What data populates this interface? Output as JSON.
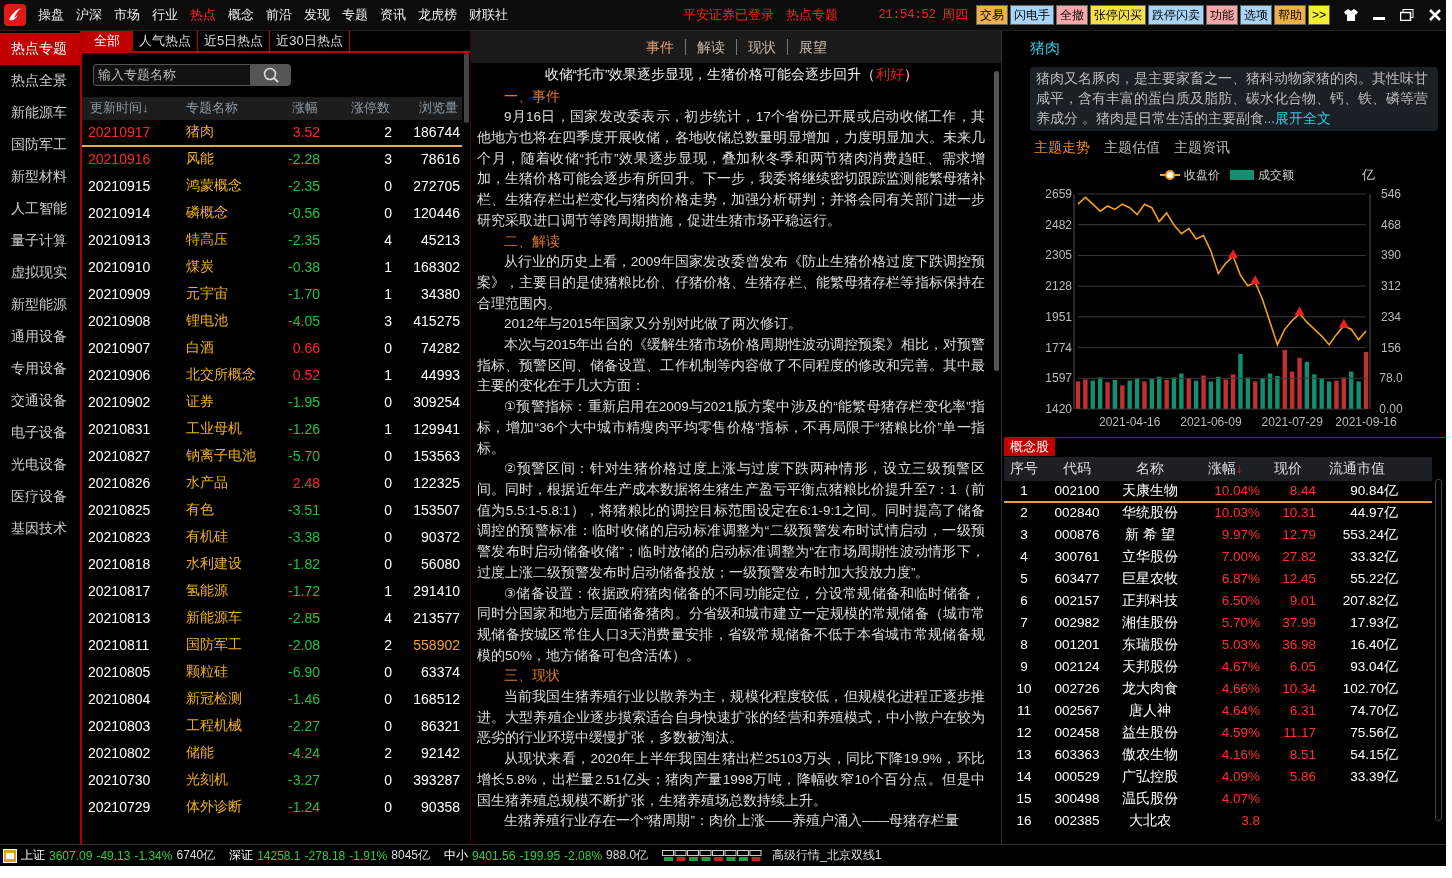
{
  "menu": {
    "items": [
      {
        "label": "操盘",
        "selected": false
      },
      {
        "label": "沪深",
        "selected": false
      },
      {
        "label": "市场",
        "selected": false
      },
      {
        "label": "行业",
        "selected": false
      },
      {
        "label": "热点",
        "selected": true
      },
      {
        "label": "概念",
        "selected": false
      },
      {
        "label": "前沿",
        "selected": false
      },
      {
        "label": "发现",
        "selected": false
      },
      {
        "label": "专题",
        "selected": false
      },
      {
        "label": "资讯",
        "selected": false
      },
      {
        "label": "龙虎榜",
        "selected": false
      },
      {
        "label": "财联社",
        "selected": false
      }
    ],
    "login_status": "平安证券已登录",
    "page_title": "热点专题",
    "time": "21:54:52",
    "weekday": "周四",
    "buttons": [
      {
        "label": "交易",
        "color": "#f0b048"
      },
      {
        "label": "闪电手",
        "color": "#a8d4f8"
      },
      {
        "label": "全撤",
        "color": "#f8a8a8"
      },
      {
        "label": "张停闪买",
        "color": "#f8e048"
      },
      {
        "label": "跌停闪卖",
        "color": "#a8d4f8"
      },
      {
        "label": "功能",
        "color": "#f8a8a8"
      },
      {
        "label": "选项",
        "color": "#a8d4f8"
      },
      {
        "label": "帮助",
        "color": "#f0b048"
      },
      {
        "label": ">>",
        "color": "#f0f030"
      }
    ]
  },
  "sidebar": {
    "items": [
      {
        "label": "热点专题",
        "selected": true
      },
      {
        "label": "热点全景",
        "selected": false
      },
      {
        "label": "新能源车",
        "selected": false
      },
      {
        "label": "国防军工",
        "selected": false
      },
      {
        "label": "新型材料",
        "selected": false
      },
      {
        "label": "人工智能",
        "selected": false
      },
      {
        "label": "量子计算",
        "selected": false
      },
      {
        "label": "虚拟现实",
        "selected": false
      },
      {
        "label": "新型能源",
        "selected": false
      },
      {
        "label": "通用设备",
        "selected": false
      },
      {
        "label": "专用设备",
        "selected": false
      },
      {
        "label": "交通设备",
        "selected": false
      },
      {
        "label": "电子设备",
        "selected": false
      },
      {
        "label": "光电设备",
        "selected": false
      },
      {
        "label": "医疗设备",
        "selected": false
      },
      {
        "label": "基因技术",
        "selected": false
      }
    ]
  },
  "topics": {
    "tabs": [
      {
        "label": "全部",
        "selected": true
      },
      {
        "label": "人气热点",
        "selected": false
      },
      {
        "label": "近5日热点",
        "selected": false
      },
      {
        "label": "近30日热点",
        "selected": false
      }
    ],
    "search": {
      "placeholder": "输入专题名称"
    },
    "columns": [
      "更新时间↓",
      "专题名称",
      "涨幅",
      "涨停数",
      "浏览量"
    ],
    "rows": [
      {
        "date": "20210917",
        "recent": true,
        "name": "猪肉",
        "change": "3.52",
        "color": "#ff2828",
        "limit_ups": "2",
        "views": "186744",
        "top": false,
        "selected": true
      },
      {
        "date": "20210916",
        "recent": true,
        "name": "风能",
        "change": "-2.28",
        "color": "#20c040",
        "limit_ups": "3",
        "views": "78616",
        "top": false,
        "selected": false
      },
      {
        "date": "20210915",
        "recent": false,
        "name": "鸿蒙概念",
        "change": "-2.35",
        "color": "#20c040",
        "limit_ups": "0",
        "views": "272705",
        "top": false,
        "selected": false
      },
      {
        "date": "20210914",
        "recent": false,
        "name": "磷概念",
        "change": "-0.56",
        "color": "#20c040",
        "limit_ups": "0",
        "views": "120446",
        "top": false,
        "selected": false
      },
      {
        "date": "20210913",
        "recent": false,
        "name": "特高压",
        "change": "-2.35",
        "color": "#20c040",
        "limit_ups": "4",
        "views": "45213",
        "top": false,
        "selected": false
      },
      {
        "date": "20210910",
        "recent": false,
        "name": "煤炭",
        "change": "-0.38",
        "color": "#20c040",
        "limit_ups": "1",
        "views": "168302",
        "top": false,
        "selected": false
      },
      {
        "date": "20210909",
        "recent": false,
        "name": "元宇宙",
        "change": "-1.70",
        "color": "#20c040",
        "limit_ups": "1",
        "views": "34380",
        "top": false,
        "selected": false
      },
      {
        "date": "20210908",
        "recent": false,
        "name": "锂电池",
        "change": "-4.05",
        "color": "#20c040",
        "limit_ups": "3",
        "views": "415275",
        "top": false,
        "selected": false
      },
      {
        "date": "20210907",
        "recent": false,
        "name": "白酒",
        "change": "0.66",
        "color": "#ff2828",
        "limit_ups": "0",
        "views": "74282",
        "top": false,
        "selected": false
      },
      {
        "date": "20210906",
        "recent": false,
        "name": "北交所概念",
        "change": "0.52",
        "color": "#ff2828",
        "limit_ups": "1",
        "views": "44993",
        "top": false,
        "selected": false
      },
      {
        "date": "20210902",
        "recent": false,
        "name": "证券",
        "change": "-1.95",
        "color": "#20c040",
        "limit_ups": "0",
        "views": "309254",
        "top": false,
        "selected": false
      },
      {
        "date": "20210831",
        "recent": false,
        "name": "工业母机",
        "change": "-1.26",
        "color": "#20c040",
        "limit_ups": "1",
        "views": "129941",
        "top": false,
        "selected": false
      },
      {
        "date": "20210827",
        "recent": false,
        "name": "钠离子电池",
        "change": "-5.70",
        "color": "#20c040",
        "limit_ups": "0",
        "views": "153563",
        "top": false,
        "selected": false
      },
      {
        "date": "20210826",
        "recent": false,
        "name": "水产品",
        "change": "2.48",
        "color": "#ff2828",
        "limit_ups": "0",
        "views": "122325",
        "top": false,
        "selected": false
      },
      {
        "date": "20210825",
        "recent": false,
        "name": "有色",
        "change": "-3.51",
        "color": "#20c040",
        "limit_ups": "0",
        "views": "153507",
        "top": false,
        "selected": false
      },
      {
        "date": "20210823",
        "recent": false,
        "name": "有机硅",
        "change": "-3.38",
        "color": "#20c040",
        "limit_ups": "0",
        "views": "90372",
        "top": false,
        "selected": false
      },
      {
        "date": "20210818",
        "recent": false,
        "name": "水利建设",
        "change": "-1.82",
        "color": "#20c040",
        "limit_ups": "0",
        "views": "56080",
        "top": false,
        "selected": false
      },
      {
        "date": "20210817",
        "recent": false,
        "name": "氢能源",
        "change": "-1.72",
        "color": "#20c040",
        "limit_ups": "1",
        "views": "291410",
        "top": false,
        "selected": false
      },
      {
        "date": "20210813",
        "recent": false,
        "name": "新能源车",
        "change": "-2.85",
        "color": "#20c040",
        "limit_ups": "4",
        "views": "213577",
        "top": false,
        "selected": false
      },
      {
        "date": "20210811",
        "recent": false,
        "name": "国防军工",
        "change": "-2.08",
        "color": "#20c040",
        "limit_ups": "2",
        "views": "558902",
        "top": true,
        "selected": false
      },
      {
        "date": "20210805",
        "recent": false,
        "name": "颗粒硅",
        "change": "-6.90",
        "color": "#20c040",
        "limit_ups": "0",
        "views": "63374",
        "top": false,
        "selected": false
      },
      {
        "date": "20210804",
        "recent": false,
        "name": "新冠检测",
        "change": "-1.46",
        "color": "#20c040",
        "limit_ups": "0",
        "views": "168512",
        "top": false,
        "selected": false
      },
      {
        "date": "20210803",
        "recent": false,
        "name": "工程机械",
        "change": "-2.27",
        "color": "#20c040",
        "limit_ups": "0",
        "views": "86321",
        "top": false,
        "selected": false
      },
      {
        "date": "20210802",
        "recent": false,
        "name": "储能",
        "change": "-4.24",
        "color": "#20c040",
        "limit_ups": "2",
        "views": "92142",
        "top": false,
        "selected": false
      },
      {
        "date": "20210730",
        "recent": false,
        "name": "光刻机",
        "change": "-3.27",
        "color": "#20c040",
        "limit_ups": "0",
        "views": "393287",
        "top": false,
        "selected": false
      },
      {
        "date": "20210729",
        "recent": false,
        "name": "体外诊断",
        "change": "-1.24",
        "color": "#20c040",
        "limit_ups": "0",
        "views": "90358",
        "top": false,
        "selected": false
      }
    ]
  },
  "article": {
    "tabs": [
      {
        "label": "事件",
        "selected": true
      },
      {
        "label": "解读",
        "selected": false
      },
      {
        "label": "现状",
        "selected": false
      },
      {
        "label": "展望",
        "selected": false
      }
    ],
    "title": "收储“托市”效果逐步显现，生猪价格可能会逐步回升（",
    "title_tag": "利好",
    "title_end": "）",
    "blocks": [
      {
        "kind": "heading",
        "text": "一、事件"
      },
      {
        "kind": "para",
        "text": "9月16日，国家发改委表示，初步统计，17个省份已开展或启动收储工作，其他地方也将在四季度开展收储，各地收储总数量明显增加，力度明显加大。未来几个月，随着收储“托市”效果逐步显现，叠加秋冬季和两节猪肉消费趋旺、需求增加，生猪价格可能会逐步有所回升。下一步，我委将继续密切跟踪监测能繁母猪补栏、生猪存栏出栏变化与猪肉价格走势，加强分析研判；并将会同有关部门进一步研究采取进口调节等跨周期措施，促进生猪市场平稳运行。"
      },
      {
        "kind": "heading",
        "text": "二、解读"
      },
      {
        "kind": "para",
        "text": "从行业的历史上看，2009年国家发改委曾发布《防止生猪价格过度下跌调控预案》，主要目的是使猪粮比价、仔猪价格、生猪存栏、能繁母猪存栏等指标保持在合理范围内。"
      },
      {
        "kind": "para",
        "text": "2012年与2015年国家又分别对此做了两次修订。"
      },
      {
        "kind": "para",
        "text": "本次与2015年出台的《缓解生猪市场价格周期性波动调控预案》相比，对预警指标、预警区间、储备设置、工作机制等内容做了不同程度的修改和完善。其中最主要的变化在于几大方面："
      },
      {
        "kind": "para",
        "text": "①预警指标：重新启用在2009与2021版方案中涉及的“能繁母猪存栏变化率”指标，增加“36个大中城市精瘦肉平均零售价格”指标，不再局限于“猪粮比价”单一指标。"
      },
      {
        "kind": "para",
        "text": "②预警区间：针对生猪价格过度上涨与过度下跌两种情形，设立三级预警区间。同时，根据近年生产成本数据将生猪生产盈亏平衡点猪粮比价提升至7：1（前值为5.5:1-5.8:1），将猪粮比的调控目标范围设定在6:1-9:1之间。同时提高了储备调控的预警标准：临时收储的启动标准调整为“二级预警发布时试情启动，一级预警发布时启动储备收储”；临时放储的启动标准调整为“在市场周期性波动情形下，过度上涨二级预警发布时启动储备投放；一级预警发布时加大投放力度”。"
      },
      {
        "kind": "para",
        "text": "③储备设置：依据政府猪肉储备的不同功能定位，分设常规储备和临时储备，同时分国家和地方层面储备猪肉。分省级和城市建立一定规模的常规储备（城市常规储备按城区常住人口3天消费量安排，省级常规储备不低于本省城市常规储备规模的50%，地方储备可包含活体）。"
      },
      {
        "kind": "heading",
        "text": "三、现状"
      },
      {
        "kind": "para",
        "text": "当前我国生猪养殖行业以散养为主，规模化程度较低，但规模化进程正逐步推进。大型养殖企业逐步摸索适合自身快速扩张的经营和养殖模式，中小散户在较为恶劣的行业环境中缓慢扩张，多数被淘汰。"
      },
      {
        "kind": "para",
        "text": "从现状来看，2020年上半年我国生猪出栏25103万头，同比下降19.9%，环比增长5.8%，出栏量2.51亿头；猪肉产量1998万吨，降幅收窄10个百分点。但是中国生猪养殖总规模不断扩张，生猪养殖场总数持续上升。"
      },
      {
        "kind": "para",
        "text": "生猪养殖行业存在一个“猪周期”：肉价上涨——养殖户涌入——母猪存栏量"
      }
    ]
  },
  "detail": {
    "title": "猪肉",
    "description": "猪肉又名豚肉，是主要家畜之一、猪科动物家猪的肉。其性味甘咸平，含有丰富的蛋白质及脂肪、碳水化合物、钙、铁、磷等营养成分 。猪肉是日常生活的主要副食...",
    "more_link": "展开全文",
    "tabs": [
      {
        "label": "主题走势",
        "selected": true
      },
      {
        "label": "主题估值",
        "selected": false
      },
      {
        "label": "主题资讯",
        "selected": false
      }
    ],
    "chart_data": {
      "type": "line",
      "grid": true,
      "categories": [
        null,
        null,
        null,
        null,
        null,
        null,
        null,
        "2021-04-16",
        null,
        null,
        null,
        null,
        null,
        null,
        null,
        null,
        null,
        null,
        "2021-06-09",
        null,
        null,
        null,
        null,
        null,
        null,
        null,
        null,
        null,
        null,
        "2021-07-29",
        null,
        null,
        null,
        null,
        null,
        null,
        null,
        null,
        null,
        "2021-09-16"
      ],
      "ylim": [
        1420,
        2659
      ],
      "yticks": [
        1420,
        1597,
        1774,
        1951,
        2128,
        2305,
        2482,
        2659
      ],
      "series": [
        {
          "name": "收盘价",
          "color": "#f0a020",
          "values": [
            2600,
            2640,
            2600,
            2560,
            2590,
            2570,
            2600,
            2580,
            2540,
            2600,
            2580,
            2500,
            2550,
            2480,
            2430,
            2460,
            2400,
            2420,
            2330,
            2200,
            2260,
            2300,
            2190,
            2130,
            2150,
            2050,
            1920,
            1790,
            1880,
            1930,
            1970,
            1920,
            1880,
            1840,
            1790,
            1850,
            1900,
            1880,
            1820,
            1870
          ]
        }
      ]
    },
    "volume": {
      "chart_data": {
        "type": "bar",
        "categories": [
          null,
          null,
          null,
          null,
          null,
          null,
          null,
          null,
          null,
          null,
          null,
          null,
          null,
          null,
          null,
          null,
          null,
          null,
          null,
          null,
          null,
          null,
          null,
          null,
          null,
          null,
          null,
          null,
          null,
          null,
          null,
          null,
          null,
          null,
          null,
          null,
          null,
          null,
          null,
          null
        ],
        "ylabel": "亿",
        "ylim": [
          0,
          546
        ],
        "yticks": [
          {
            "value": 0,
            "label": "0.00"
          },
          {
            "value": 78,
            "label": "78.0"
          },
          {
            "value": 156,
            "label": "156"
          },
          {
            "value": 234,
            "label": "234"
          },
          {
            "value": 312,
            "label": "312"
          },
          {
            "value": 390,
            "label": "390"
          },
          {
            "value": 468,
            "label": "468"
          },
          {
            "value": 546,
            "label": "546"
          }
        ],
        "series": [
          {
            "name": "成交额",
            "color": "#109070",
            "values": [
              null,
              null,
              72,
              80,
              null,
              74,
              null,
              72,
              78,
              null,
              76,
              82,
              null,
              80,
              90,
              null,
              72,
              null,
              70,
              82,
              null,
              null,
              140,
              80,
              null,
              78,
              90,
              84,
              null,
              null,
              null,
              120,
              88,
              78,
              70,
              null,
              null,
              95,
              70,
              null
            ]
          },
          {
            "color": "#c03030",
            "values": [
              70,
              75,
              null,
              null,
              68,
              null,
              60,
              null,
              null,
              70,
              null,
              null,
              74,
              null,
              null,
              78,
              null,
              85,
              null,
              null,
              75,
              88,
              null,
              null,
              70,
              null,
              null,
              null,
              150,
              95,
              130,
              null,
              null,
              null,
              null,
              72,
              80,
              null,
              null,
              145
            ]
          }
        ]
      }
    }
  },
  "concept_stocks": {
    "title": "概念股",
    "columns": [
      {
        "label": "序号"
      },
      {
        "label": "代码"
      },
      {
        "label": "名称"
      },
      {
        "label": "涨幅",
        "sort_mark": "↓"
      },
      {
        "label": "现价"
      },
      {
        "label": "流通市值"
      }
    ],
    "rows": [
      {
        "no": "1",
        "code": "002100",
        "name": "天康生物",
        "change": "10.04%",
        "price": "8.44",
        "cap": "90.84亿",
        "selected": true
      },
      {
        "no": "2",
        "code": "002840",
        "name": "华统股份",
        "change": "10.03%",
        "price": "10.31",
        "cap": "44.97亿",
        "selected": false
      },
      {
        "no": "3",
        "code": "000876",
        "name": "新 希 望",
        "change": "9.97%",
        "price": "12.79",
        "cap": "553.24亿",
        "selected": false
      },
      {
        "no": "4",
        "code": "300761",
        "name": "立华股份",
        "change": "7.00%",
        "price": "27.82",
        "cap": "33.32亿",
        "selected": false
      },
      {
        "no": "5",
        "code": "603477",
        "name": "巨星农牧",
        "change": "6.87%",
        "price": "12.45",
        "cap": "55.22亿",
        "selected": false
      },
      {
        "no": "6",
        "code": "002157",
        "name": "正邦科技",
        "change": "6.50%",
        "price": "9.01",
        "cap": "207.82亿",
        "selected": false
      },
      {
        "no": "7",
        "code": "002982",
        "name": "湘佳股份",
        "change": "5.70%",
        "price": "37.99",
        "cap": "17.93亿",
        "selected": false
      },
      {
        "no": "8",
        "code": "001201",
        "name": "东瑞股份",
        "change": "5.03%",
        "price": "36.98",
        "cap": "16.40亿",
        "selected": false
      },
      {
        "no": "9",
        "code": "002124",
        "name": "天邦股份",
        "change": "4.67%",
        "price": "6.05",
        "cap": "93.04亿",
        "selected": false
      },
      {
        "no": "10",
        "code": "002726",
        "name": "龙大肉食",
        "change": "4.66%",
        "price": "10.34",
        "cap": "102.70亿",
        "selected": false
      },
      {
        "no": "11",
        "code": "002567",
        "name": "唐人神",
        "change": "4.64%",
        "price": "6.31",
        "cap": "74.70亿",
        "selected": false
      },
      {
        "no": "12",
        "code": "002458",
        "name": "益生股份",
        "change": "4.59%",
        "price": "11.17",
        "cap": "75.56亿",
        "selected": false
      },
      {
        "no": "13",
        "code": "603363",
        "name": "傲农生物",
        "change": "4.16%",
        "price": "8.51",
        "cap": "54.15亿",
        "selected": false
      },
      {
        "no": "14",
        "code": "000529",
        "name": "广弘控股",
        "change": "4.09%",
        "price": "5.86",
        "cap": "33.39亿",
        "selected": false
      },
      {
        "no": "15",
        "code": "300498",
        "name": "温氏股份",
        "change": "4.07%",
        "selected": false
      },
      {
        "no": "16",
        "code": "002385",
        "name": "大北农",
        "change": "3.8",
        "selected": false
      }
    ]
  },
  "status_bar": {
    "indices": [
      {
        "name": "上证",
        "last": "3607.09",
        "change": "-49.13",
        "pct": "-1.34%",
        "amount": "6740亿",
        "color": "#30d040"
      },
      {
        "name": "深证",
        "last": "14258.1",
        "change": "-278.18",
        "pct": "-1.91%",
        "amount": "8045亿",
        "color": "#30d040"
      },
      {
        "name": "中小",
        "last": "9401.56",
        "change": "-199.95",
        "pct": "-2.08%",
        "amount": "988.0亿",
        "color": "#30d040"
      }
    ],
    "connection": "高级行情_北京双线1"
  }
}
